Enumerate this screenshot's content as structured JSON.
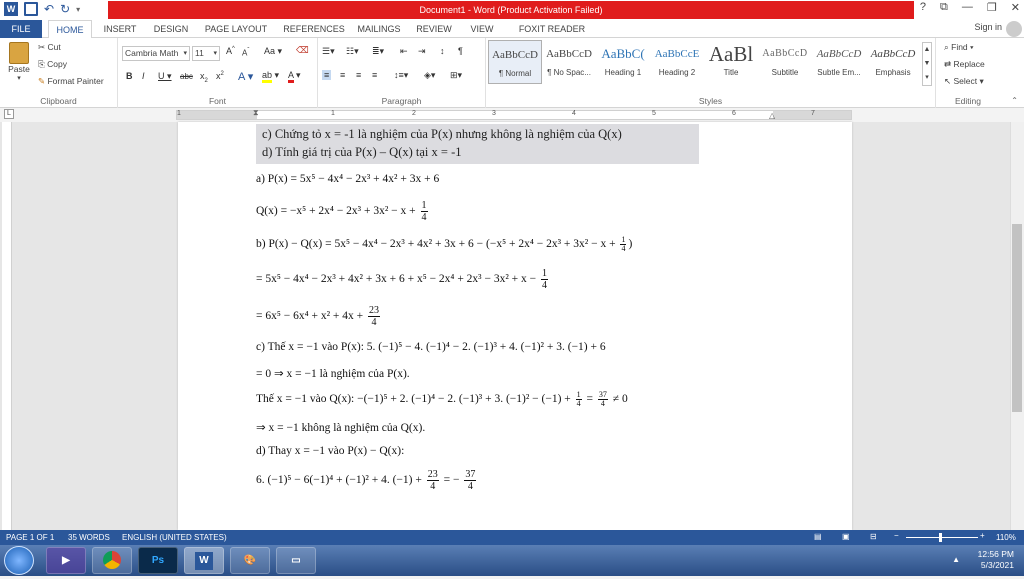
{
  "window": {
    "title": "Document1 - Word (Product Activation Failed)",
    "controls": [
      "?",
      "⧉",
      "—",
      "❐",
      "✕"
    ]
  },
  "tabs": [
    "FILE",
    "HOME",
    "INSERT",
    "DESIGN",
    "PAGE LAYOUT",
    "REFERENCES",
    "MAILINGS",
    "REVIEW",
    "VIEW",
    "FOXIT READER PDF"
  ],
  "active_tab": "HOME",
  "signin": "Sign in",
  "clipboard": {
    "paste": "Paste",
    "cut": "Cut",
    "copy": "Copy",
    "format_painter": "Format Painter",
    "label": "Clipboard"
  },
  "font": {
    "name": "Cambria Math",
    "size": "11",
    "grow": "A",
    "shrink": "A",
    "case": "Aa",
    "label": "Font"
  },
  "paragraph": {
    "label": "Paragraph"
  },
  "styles": {
    "label": "Styles",
    "items": [
      {
        "sample": "AaBbCcD",
        "name": "¶ Normal"
      },
      {
        "sample": "AaBbCcD",
        "name": "¶ No Spac..."
      },
      {
        "sample": "AaBbC(",
        "name": "Heading 1"
      },
      {
        "sample": "AaBbCcE",
        "name": "Heading 2"
      },
      {
        "sample": "AaBl",
        "name": "Title"
      },
      {
        "sample": "AaBbCcD",
        "name": "Subtitle"
      },
      {
        "sample": "AaBbCcD",
        "name": "Subtle Em..."
      },
      {
        "sample": "AaBbCcD",
        "name": "Emphasis"
      }
    ]
  },
  "editing": {
    "find": "Find",
    "replace": "Replace",
    "select": "Select",
    "label": "Editing"
  },
  "ruler_numbers": [
    "1",
    "1",
    "2",
    "3",
    "4",
    "5",
    "6",
    "7"
  ],
  "document": {
    "excerpt_c": "c)  Chứng tỏ x = -1 là nghiệm của P(x) nhưng không là nghiệm của Q(x)",
    "excerpt_d": "d)  Tính giá trị của P(x) – Q(x) tại x = -1",
    "line_a": "a) P(x) = 5x⁵ − 4x⁴ − 2x³ + 4x² + 3x + 6",
    "line_q": "Q(x) = −x⁵ + 2x⁴ − 2x³ + 3x² − x +",
    "line_b": "b) P(x) − Q(x) = 5x⁵ − 4x⁴ − 2x³ + 4x² + 3x + 6 − (−x⁵ + 2x⁴ − 2x³ + 3x² − x +",
    "line_b_close": ")",
    "line_b2": "= 5x⁵ − 4x⁴ − 2x³ + 4x² + 3x + 6 + x⁵ − 2x⁴ + 2x³ − 3x² + x −",
    "line_b3": "= 6x⁵ − 6x⁴ + x² + 4x +",
    "line_c1": "c) Thế x = −1 vào P(x): 5. (−1)⁵ − 4. (−1)⁴ − 2. (−1)³ + 4. (−1)² + 3. (−1) + 6",
    "line_c2": "= 0 ⇒ x = −1 là nghiệm của P(x).",
    "line_c3": "Thế x = −1 vào Q(x): −(−1)⁵ + 2. (−1)⁴ − 2. (−1)³ + 3. (−1)² − (−1) +",
    "line_c3_tail": "≠ 0",
    "line_c4": "⇒ x = −1 không là nghiệm của Q(x).",
    "line_d1": "d) Thay x = −1 vào P(x) − Q(x):",
    "line_d2": "6. (−1)⁵ − 6(−1)⁴ + (−1)² + 4. (−1) +",
    "frac_1": "1",
    "frac_4": "4",
    "frac_23": "23",
    "frac_37": "37",
    "eq_minus": "= −",
    "eq": "="
  },
  "status": {
    "page": "PAGE 1 OF 1",
    "words": "35 WORDS",
    "language": "ENGLISH (UNITED STATES)",
    "zoom": "110%"
  },
  "taskbar": {
    "time": "12:56 PM",
    "date": "5/3/2021",
    "apps": [
      "IE",
      "Chrome",
      "Ps",
      "W",
      "Paint",
      "Files"
    ]
  },
  "colors": {
    "word_blue": "#2b579a",
    "title_red": "#e01c1c"
  }
}
